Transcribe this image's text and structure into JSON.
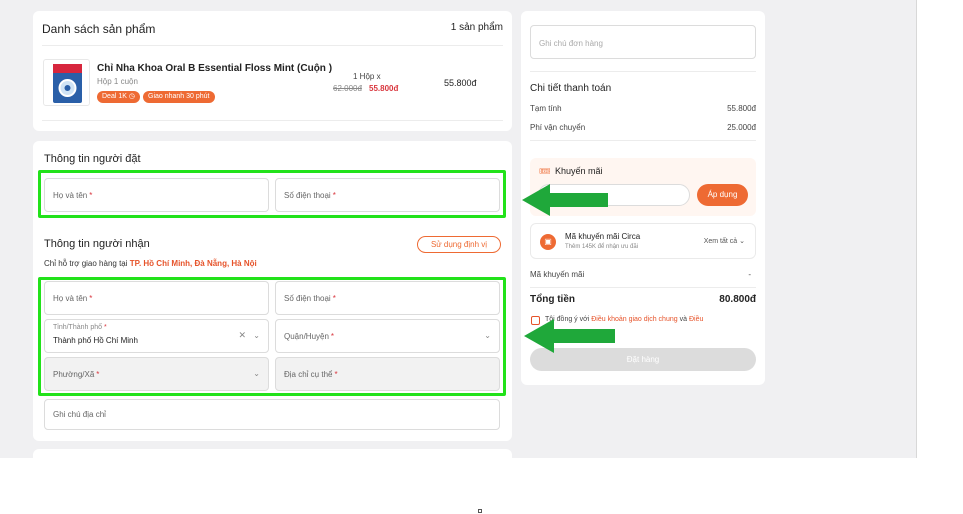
{
  "product_section": {
    "title": "Danh sách sản phẩm",
    "count": "1 sản phẩm",
    "item": {
      "name": "Chỉ Nha Khoa Oral B Essential Floss Mint (Cuộn )",
      "variant": "Hộp 1 cuộn",
      "tags": [
        "Deal 1K",
        "Giao nhanh 30 phút"
      ],
      "quantity": "1 Hộp x",
      "old_price": "62.000đ",
      "new_price": "55.800đ",
      "line_total": "55.800đ"
    }
  },
  "orderer": {
    "title": "Thông tin người đặt",
    "name_label": "Họ và tên",
    "phone_label": "Số điện thoại"
  },
  "receiver": {
    "title": "Thông tin người nhận",
    "locate_button": "Sử dụng định vị",
    "coverage_prefix": "Chỉ hỗ trợ giao hàng tại",
    "coverage_cities": "TP. Hồ Chí Minh, Đà Nẵng, Hà Nội",
    "name_label": "Họ và tên",
    "phone_label": "Số điện thoại",
    "city_label": "Tỉnh/Thành phố",
    "city_value": "Thành phố Hồ Chí Minh",
    "district_label": "Quận/Huyện",
    "ward_label": "Phường/Xã",
    "address_label": "Địa chỉ cụ thể",
    "note_label": "Ghi chú địa chỉ"
  },
  "summary": {
    "order_note_placeholder": "Ghi chú đơn hàng",
    "payment_title": "Chi tiết thanh toán",
    "subtotal_label": "Tạm tính",
    "subtotal_value": "55.800đ",
    "shipping_label": "Phí vận chuyển",
    "shipping_value": "25.000đ",
    "promo_title": "Khuyến mãi",
    "apply_button": "Áp dụng",
    "voucher_title": "Mã khuyến mãi Circa",
    "voucher_sub": "Thêm 145K để nhận ưu đãi",
    "voucher_link": "Xem tất cả",
    "promo_code_label": "Mã khuyến mãi",
    "promo_code_value": "-",
    "total_label": "Tổng tiền",
    "total_value": "80.800đ",
    "terms_prefix": "Tôi đồng ý với",
    "terms_link": "Điều khoản giao dịch chung",
    "terms_and": "và",
    "terms_link2": "Điều",
    "place_order_button": "Đặt hàng"
  },
  "colors": {
    "accent": "#ee6a33",
    "highlight": "#22e21a",
    "arrow": "#1fa83a",
    "required": "#d9363e"
  }
}
